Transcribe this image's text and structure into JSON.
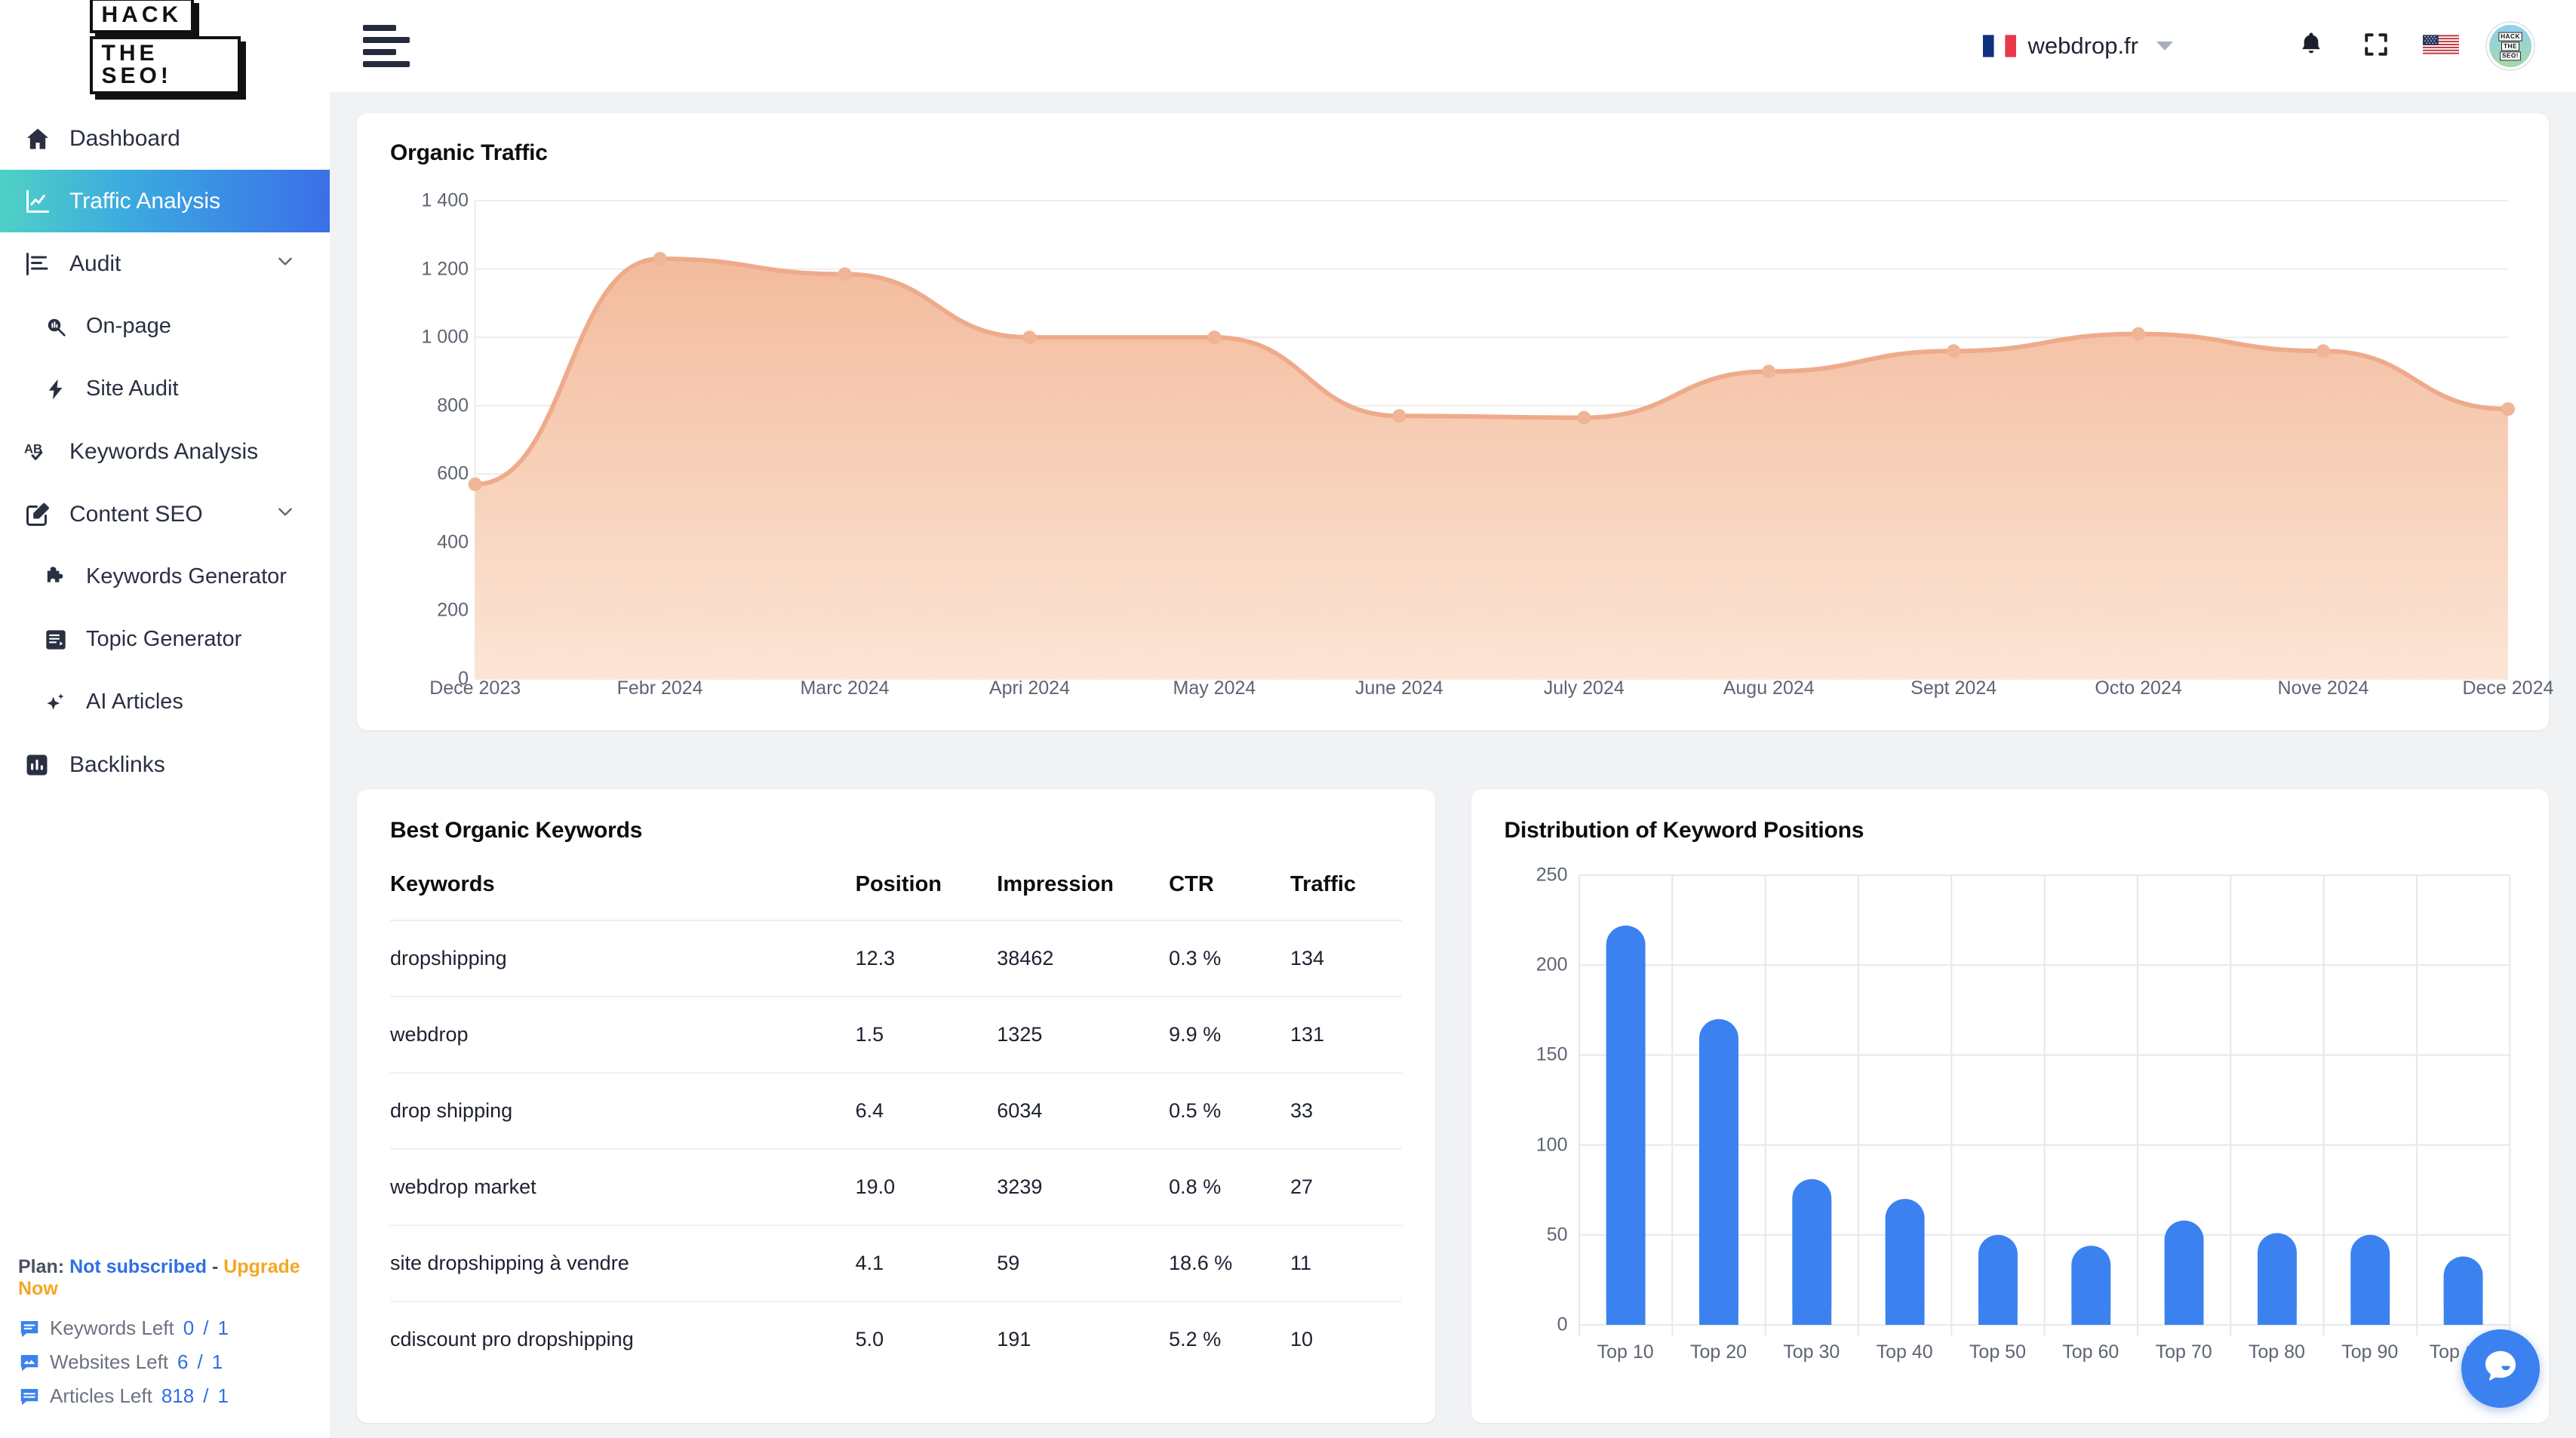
{
  "brand": {
    "line1": "HACK",
    "line2": "THE SEO!"
  },
  "sidebar": {
    "items": [
      {
        "label": "Dashboard",
        "icon": "home-icon",
        "level": "top",
        "active": false
      },
      {
        "label": "Traffic Analysis",
        "icon": "chart-line-icon",
        "level": "top",
        "active": true
      },
      {
        "label": "Audit",
        "icon": "bar-chart-icon",
        "level": "top",
        "active": false,
        "expandable": true
      },
      {
        "label": "On-page",
        "icon": "search-chart-icon",
        "level": "sub",
        "active": false
      },
      {
        "label": "Site Audit",
        "icon": "bolt-icon",
        "level": "sub",
        "active": false
      },
      {
        "label": "Keywords Analysis",
        "icon": "ab-check-icon",
        "level": "top",
        "active": false
      },
      {
        "label": "Content SEO",
        "icon": "edit-square-icon",
        "level": "top",
        "active": false,
        "expandable": true
      },
      {
        "label": "Keywords Generator",
        "icon": "puzzle-icon",
        "level": "sub",
        "active": false
      },
      {
        "label": "Topic Generator",
        "icon": "note-edit-icon",
        "level": "sub",
        "active": false
      },
      {
        "label": "AI Articles",
        "icon": "sparkle-icon",
        "level": "sub",
        "active": false
      },
      {
        "label": "Backlinks",
        "icon": "bar-chart-box-icon",
        "level": "top",
        "active": false
      }
    ],
    "plan": {
      "prefix": "Plan:",
      "status": "Not subscribed",
      "separator": "-",
      "upgrade": "Upgrade Now",
      "quotas": [
        {
          "label": "Keywords Left",
          "used": "0",
          "slash": "/",
          "total": "1",
          "icon": "chat-box-icon"
        },
        {
          "label": "Websites Left",
          "used": "6",
          "slash": "/",
          "total": "1",
          "icon": "image-box-icon"
        },
        {
          "label": "Articles Left",
          "used": "818",
          "slash": "/",
          "total": "1",
          "icon": "chat-lines-icon"
        }
      ]
    }
  },
  "topbar": {
    "menu_icon": "hamburger-icon",
    "domain": "webdrop.fr",
    "domain_flag": "flag-france-icon",
    "caret": "chevron-down-icon",
    "notifications_icon": "bell-icon",
    "fullscreen_icon": "fullscreen-icon",
    "language_icon": "flag-usa-icon",
    "avatar_icon": "user-avatar"
  },
  "cards": {
    "traffic_title": "Organic Traffic",
    "keywords_title": "Best Organic Keywords",
    "distribution_title": "Distribution of Keyword Positions"
  },
  "keywords_table": {
    "headers": [
      "Keywords",
      "Position",
      "Impression",
      "CTR",
      "Traffic"
    ],
    "rows": [
      {
        "keyword": "dropshipping",
        "position": "12.3",
        "impression": "38462",
        "ctr": "0.3 %",
        "traffic": "134"
      },
      {
        "keyword": "webdrop",
        "position": "1.5",
        "impression": "1325",
        "ctr": "9.9 %",
        "traffic": "131"
      },
      {
        "keyword": "drop shipping",
        "position": "6.4",
        "impression": "6034",
        "ctr": "0.5 %",
        "traffic": "33"
      },
      {
        "keyword": "webdrop market",
        "position": "19.0",
        "impression": "3239",
        "ctr": "0.8 %",
        "traffic": "27"
      },
      {
        "keyword": "site dropshipping à vendre",
        "position": "4.1",
        "impression": "59",
        "ctr": "18.6 %",
        "traffic": "11"
      },
      {
        "keyword": "cdiscount pro dropshipping",
        "position": "5.0",
        "impression": "191",
        "ctr": "5.2 %",
        "traffic": "10"
      }
    ]
  },
  "chart_data": [
    {
      "type": "area",
      "title": "Organic Traffic",
      "xlabel": "",
      "ylabel": "",
      "categories": [
        "Dece 2023",
        "Febr 2024",
        "Marc 2024",
        "Apri 2024",
        "May  2024",
        "June 2024",
        "July 2024",
        "Augu 2024",
        "Sept 2024",
        "Octo 2024",
        "Nove 2024",
        "Dece 2024"
      ],
      "x_tick_labels": [
        "Dece 2023",
        "Febr 2024",
        "Marc 2024",
        "Apri 2024",
        "May  2024",
        "June 2024",
        "July 2024",
        "Augu 2024",
        "Sept 2024",
        "Octo 2024",
        "Nove 2024",
        "Dece 2024"
      ],
      "values": [
        570,
        1230,
        1185,
        1000,
        1000,
        770,
        765,
        900,
        960,
        1010,
        960,
        790
      ],
      "y_tick_labels": [
        "0",
        "200",
        "400",
        "600",
        "800",
        "1 000",
        "1 200",
        "1 400"
      ],
      "ylim": [
        0,
        1400
      ],
      "y_step": 200,
      "grid": true,
      "legend": "none",
      "line_color": "#eeab8b",
      "fill_color_top": "#f5c4a8",
      "fill_color_bottom": "#fbe3d2"
    },
    {
      "type": "bar",
      "title": "Distribution of Keyword Positions",
      "xlabel": "",
      "ylabel": "",
      "categories": [
        "Top 10",
        "Top 20",
        "Top 30",
        "Top 40",
        "Top 50",
        "Top 60",
        "Top 70",
        "Top 80",
        "Top 90",
        "Top 100"
      ],
      "values": [
        222,
        170,
        81,
        70,
        50,
        44,
        58,
        51,
        50,
        38
      ],
      "y_tick_labels": [
        "0",
        "50",
        "100",
        "150",
        "200",
        "250"
      ],
      "ylim": [
        0,
        250
      ],
      "y_step": 50,
      "grid": true,
      "legend": "none",
      "bar_color": "#3b82f0"
    }
  ],
  "chat": {
    "icon": "chat-bubble-icon",
    "color": "#3b82f0"
  }
}
